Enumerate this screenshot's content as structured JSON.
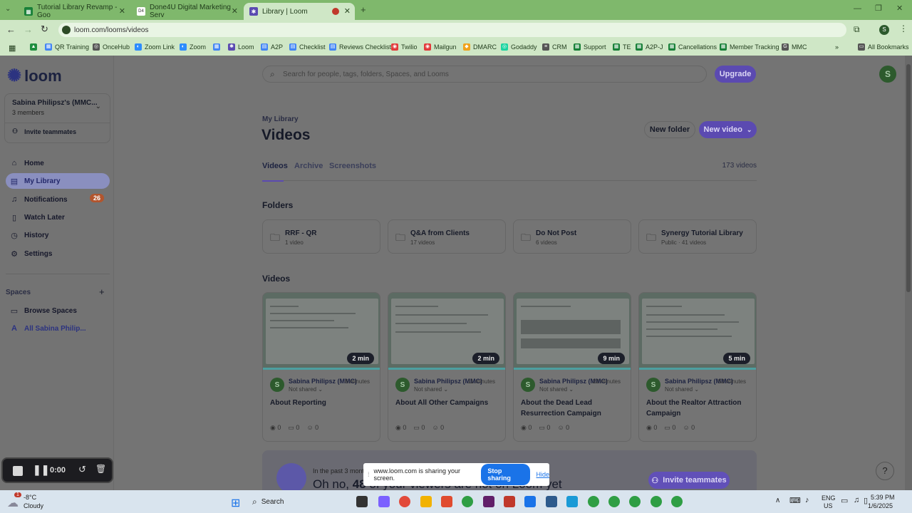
{
  "browser": {
    "tabs": [
      {
        "title": "Tutorial Library Revamp - Goo",
        "left": 0
      },
      {
        "title": "Done4U Digital Marketing Serv",
        "left": 0
      },
      {
        "title": "Library | Loom",
        "left": 0
      }
    ],
    "url": "loom.com/looms/videos",
    "bookmarks": [
      "QR Training",
      "OnceHub",
      "Zoom Link",
      "Zoom",
      "Loom",
      "A2P",
      "Checklist",
      "Reviews Checklist",
      "Twilio",
      "Mailgun",
      "DMARC",
      "Godaddy",
      "CRM",
      "Support",
      "TE",
      "A2P-J",
      "Cancellations",
      "Member Tracking",
      "MMC"
    ],
    "all_bookmarks": "All Bookmarks"
  },
  "sidebar": {
    "logo": "loom",
    "workspace_name": "Sabina Philipsz's (MMC...",
    "workspace_members": "3 members",
    "invite": "Invite teammates",
    "nav": [
      {
        "label": "Home",
        "icon": "home-icon"
      },
      {
        "label": "My Library",
        "icon": "library-icon"
      },
      {
        "label": "Notifications",
        "icon": "bell-icon",
        "badge": "26"
      },
      {
        "label": "Watch Later",
        "icon": "bookmark-icon"
      },
      {
        "label": "History",
        "icon": "clock-icon"
      },
      {
        "label": "Settings",
        "icon": "gear-icon"
      }
    ],
    "spaces_header": "Spaces",
    "spaces": [
      {
        "label": "Browse Spaces"
      },
      {
        "label": "All Sabina Philip..."
      }
    ]
  },
  "main": {
    "search_placeholder": "Search for people, tags, folders, Spaces, and Looms",
    "upgrade": "Upgrade",
    "avatar": "S",
    "breadcrumb": "My Library",
    "title": "Videos",
    "new_folder": "New folder",
    "new_video": "New video",
    "tabs": [
      "Videos",
      "Archive",
      "Screenshots"
    ],
    "video_count": "173 videos",
    "folders_header": "Folders",
    "folders": [
      {
        "name": "RRF - QR",
        "sub": "1 video"
      },
      {
        "name": "Q&A from Clients",
        "sub": "17 videos"
      },
      {
        "name": "Do Not Post",
        "sub": "6 videos"
      },
      {
        "name": "Synergy Tutorial Library",
        "sub": "Public · 41 videos"
      }
    ],
    "videos_header": "Videos",
    "videos": [
      {
        "duration": "2 min",
        "author": "Sabina Philipsz (MMC)",
        "shared": "Not shared",
        "ago": "6 minutes",
        "title": "About Reporting",
        "views": "0",
        "comments": "0",
        "reactions": "0"
      },
      {
        "duration": "2 min",
        "author": "Sabina Philipsz (MMC)",
        "shared": "Not shared",
        "ago": "11 minutes",
        "title": "About All Other Campaigns",
        "views": "0",
        "comments": "0",
        "reactions": "0"
      },
      {
        "duration": "9 min",
        "author": "Sabina Philipsz (MMC)",
        "shared": "Not shared",
        "ago": "22 minutes",
        "title": "About the Dead Lead Resurrection Campaign",
        "views": "0",
        "comments": "0",
        "reactions": "0"
      },
      {
        "duration": "5 min",
        "author": "Sabina Philipsz (MMC)",
        "shared": "Not shared",
        "ago": "52 minutes",
        "title": "About the Realtor Attraction Campaign",
        "views": "0",
        "comments": "0",
        "reactions": "0"
      }
    ],
    "banner_small": "In the past 3 months",
    "banner_big_pre": "Oh no, ",
    "banner_big_num": "48",
    "banner_big_post": " of your viewers are not on Loom yet",
    "banner_button": "Invite teammates"
  },
  "recorder": {
    "time": "0:00"
  },
  "sharing": {
    "text": "www.loom.com is sharing your screen.",
    "stop": "Stop sharing",
    "hide": "Hide"
  },
  "taskbar": {
    "weather_temp": "-8°C",
    "weather_desc": "Cloudy",
    "weather_badge": "1",
    "search": "Search",
    "lang1": "ENG",
    "lang2": "US",
    "time": "5:39 PM",
    "date": "1/6/2025"
  }
}
